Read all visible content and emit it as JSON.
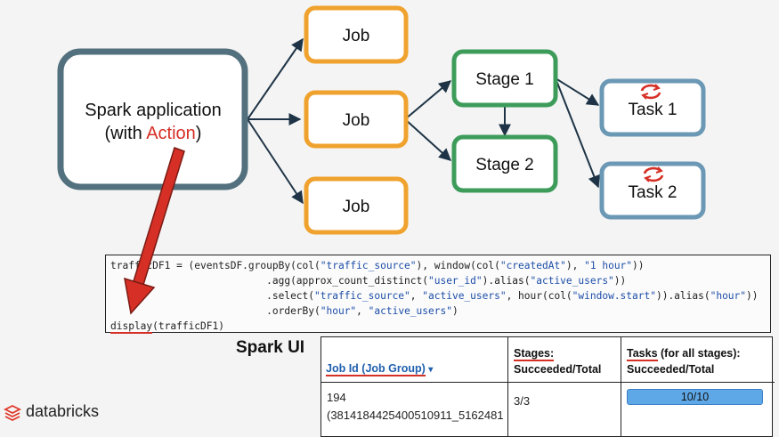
{
  "diagram": {
    "app": {
      "line1": "Spark application",
      "line2_prefix": "(with ",
      "line2_action": "Action",
      "line2_suffix": ")"
    },
    "jobs": [
      "Job",
      "Job",
      "Job"
    ],
    "stages": [
      "Stage 1",
      "Stage 2"
    ],
    "tasks": [
      "Task 1",
      "Task 2"
    ]
  },
  "code": {
    "line1_pre": "trafficDF1 = (eventsDF.groupBy(col(",
    "line1_s1": "\"traffic_source\"",
    "line1_mid": "), window(col(",
    "line1_s2": "\"createdAt\"",
    "line1_mid2": "), ",
    "line1_s3": "\"1 hour\"",
    "line1_end": "))",
    "line2_pre": "                          .agg(approx_count_distinct(",
    "line2_s1": "\"user_id\"",
    "line2_mid": ").alias(",
    "line2_s2": "\"active_users\"",
    "line2_end": "))",
    "line3_pre": "                          .select(",
    "line3_s1": "\"traffic_source\"",
    "line3_mid": ", ",
    "line3_s2": "\"active_users\"",
    "line3_mid2": ", hour(col(",
    "line3_s3": "\"window.start\"",
    "line3_mid3": ")).alias(",
    "line3_s4": "\"hour\"",
    "line3_end": "))",
    "line4_pre": "                          .orderBy(",
    "line4_s1": "\"hour\"",
    "line4_mid": ", ",
    "line4_s2": "\"active_users\"",
    "line4_end": ")",
    "line5_fn": "display",
    "line5_rest": "(trafficDF1)"
  },
  "spark_ui": {
    "title": "Spark UI",
    "col_job": "Job Id (Job Group)",
    "col_job_sort": "▾",
    "col_stages": "Stages:",
    "col_stages_sub": "Succeeded/Total",
    "col_tasks_main": "Tasks",
    "col_tasks_rest": " (for all stages):",
    "col_tasks_sub": "Succeeded/Total",
    "job_id": "194",
    "job_group": "(3814184425400510911_5162481",
    "stages_value": "3/3",
    "tasks_value": "10/10",
    "tasks_progress": 1.0
  },
  "brand": {
    "name": "databricks"
  },
  "colors": {
    "app_border": "#52707d",
    "job_border": "#f0a22e",
    "stage_border": "#3e9c5b",
    "task_border": "#6b98b5",
    "action_red": "#d62f26",
    "arrow": "#1e3446",
    "progress": "#5fa8e8"
  }
}
